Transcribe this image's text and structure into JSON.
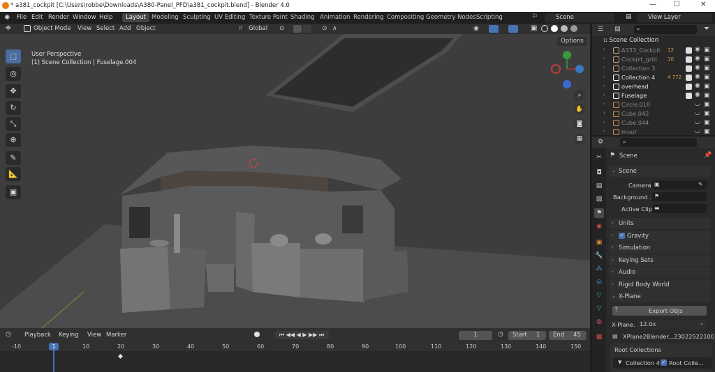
{
  "window": {
    "title": "* a381_cockpit [C:\\Users\\robbe\\Downloads\\A380-Panel_PFD\\a381_cockpit.blend] - Blender 4.0",
    "minimize": "—",
    "maximize": "☐",
    "close": "✕"
  },
  "menu": [
    "File",
    "Edit",
    "Render",
    "Window",
    "Help"
  ],
  "workspaces": [
    {
      "label": "Layout",
      "active": true
    },
    {
      "label": "Modeling"
    },
    {
      "label": "Sculpting"
    },
    {
      "label": "UV Editing"
    },
    {
      "label": "Texture Paint"
    },
    {
      "label": "Shading"
    },
    {
      "label": "Animation"
    },
    {
      "label": "Rendering"
    },
    {
      "label": "Compositing"
    },
    {
      "label": "Geometry Nodes"
    },
    {
      "label": "Scripting"
    }
  ],
  "scene_field": "Scene",
  "viewlayer_field": "View Layer",
  "viewport_header": {
    "mode": "Object Mode",
    "menus": [
      "View",
      "Select",
      "Add",
      "Object"
    ],
    "transform": "Global",
    "options": "Options"
  },
  "viewport": {
    "perspective": "User Perspective",
    "collection": "(1) Scene Collection | Fuselage.004",
    "gizmo_axes": {
      "x": "X",
      "y": "Y",
      "z": "Z"
    }
  },
  "timeline": {
    "menus": [
      "Playback",
      "Keying",
      "View",
      "Marker"
    ],
    "current_frame": "1",
    "start_label": "Start",
    "start": "1",
    "end_label": "End",
    "end": "45",
    "ruler": [
      "-10",
      "1",
      "10",
      "20",
      "30",
      "40",
      "50",
      "60",
      "70",
      "80",
      "90",
      "100",
      "110",
      "120",
      "130",
      "140",
      "150"
    ]
  },
  "outliner": {
    "search_placeholder": "",
    "root": "Scene Collection",
    "items": [
      {
        "label": "A333_Cockpit",
        "badge": "12",
        "dim": true,
        "color": "#c6a07a"
      },
      {
        "label": "Cockpit_grid",
        "badge": "10",
        "dim": true,
        "color": "#c6a07a"
      },
      {
        "label": "Collection 3",
        "badge": "",
        "dim": true,
        "color": "#c6a07a"
      },
      {
        "label": "Collection 4",
        "badge": "4 772",
        "dim": false,
        "color": "#ffffff"
      },
      {
        "label": "overhead",
        "badge": "",
        "dim": false,
        "color": "#ffffff"
      },
      {
        "label": "Fuselage",
        "badge": "",
        "dim": false,
        "color": "#ffffff"
      },
      {
        "label": "Circle.010",
        "badge": "",
        "dim": true,
        "color": "#c68e4f"
      },
      {
        "label": "Cube.042",
        "badge": "",
        "dim": true,
        "color": "#c68e4f"
      },
      {
        "label": "Cube.044",
        "badge": "",
        "dim": true,
        "color": "#c68e4f"
      },
      {
        "label": "muur",
        "badge": "",
        "dim": true,
        "color": "#c68e4f"
      }
    ]
  },
  "properties": {
    "context": "Scene",
    "panel_title": "Scene",
    "camera_label": "Camera",
    "background_label": "Background ...",
    "active_clip_label": "Active Clip",
    "sections": [
      "Units",
      "Gravity",
      "Simulation",
      "Keying Sets",
      "Audio",
      "Rigid Body World",
      "X-Plane"
    ],
    "export_button": "Export OBJs",
    "xplane_version_label": "X-Plane...",
    "xplane_version": "12.0x",
    "xplane_file": "XPlane2Blender...230225221007",
    "root_collections": "Root Collections",
    "collection_row": "Collection 4",
    "root_collection_check": "Root Colle..."
  },
  "colors": {
    "accent": "#4772b3",
    "header": "#303030",
    "panel": "#282828",
    "viewport": "#3d3d3d"
  }
}
